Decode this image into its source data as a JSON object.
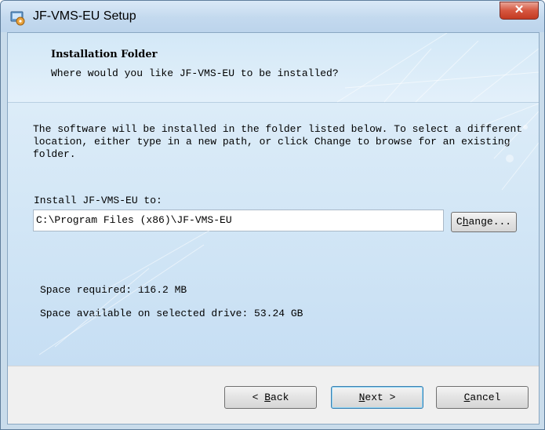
{
  "window": {
    "title": "JF-VMS-EU Setup",
    "app_icon": "installer-icon",
    "close_glyph": "✕"
  },
  "header": {
    "title": "Installation Folder",
    "subtitle": "Where would you like JF-VMS-EU to be installed?"
  },
  "content": {
    "description": "The software will be installed in the folder listed below. To select a different location, either type in a new path, or click Change to browse for an existing folder.",
    "path_label": "Install JF-VMS-EU to:",
    "path_value": "C:\\Program Files (x86)\\JF-VMS-EU",
    "change_button": {
      "access_key": "h",
      "before": "C",
      "after": "ange..."
    },
    "space_required": "Space required: 116.2 MB",
    "space_available": "Space available on selected drive: 53.24 GB"
  },
  "footer": {
    "back_button": {
      "arrow": "<",
      "access_key": "B",
      "rest": "ack"
    },
    "next_button": {
      "access_key": "N",
      "rest": "ext",
      "arrow": ">"
    },
    "cancel_button": {
      "access_key": "C",
      "rest": "ancel"
    }
  },
  "colors": {
    "title_bar": "#c3d9ee",
    "close_button": "#d6563f",
    "panel": "#cfe4f5",
    "footer": "#f0f0f0"
  }
}
